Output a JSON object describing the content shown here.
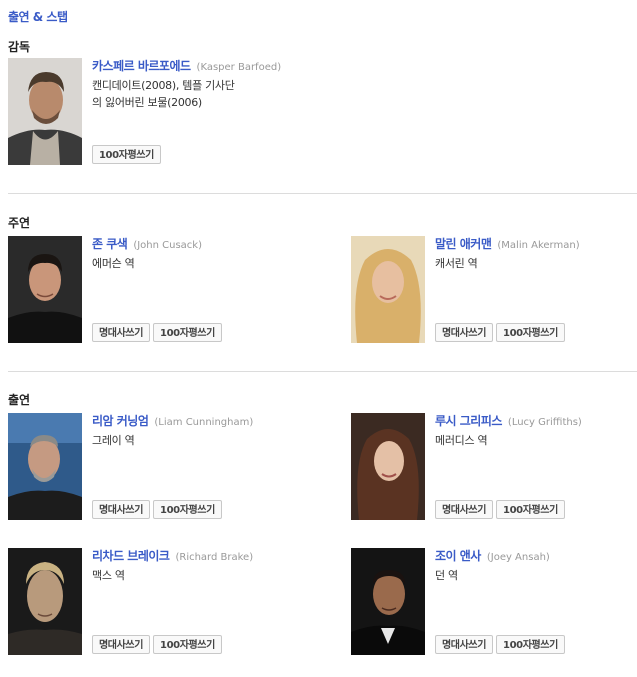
{
  "section_title": "출연 & 스탭",
  "buttons": {
    "quote": "명대사쓰기",
    "review": "100자평쓰기"
  },
  "director": {
    "label": "감독",
    "name": "카스페르 바르포에드",
    "name_en": "(Kasper Barfoed)",
    "filmography_1": "캔디데이트(2008), 템플 기사단",
    "filmography_2": "의 잃어버린 보물(2006)"
  },
  "lead": {
    "label": "주연",
    "people": [
      {
        "name": "존 쿠색",
        "name_en": "(John Cusack)",
        "role": "에머슨 역"
      },
      {
        "name": "말린 애커맨",
        "name_en": "(Malin Akerman)",
        "role": "캐서린 역"
      }
    ]
  },
  "cast": {
    "label": "출연",
    "people": [
      {
        "name": "리암 커닝엄",
        "name_en": "(Liam Cunningham)",
        "role": "그레이 역"
      },
      {
        "name": "루시 그리피스",
        "name_en": "(Lucy Griffiths)",
        "role": "메러디스 역"
      },
      {
        "name": "리차드 브레이크",
        "name_en": "(Richard Brake)",
        "role": "맥스 역"
      },
      {
        "name": "조이 앤사",
        "name_en": "(Joey Ansah)",
        "role": "던 역"
      }
    ]
  }
}
